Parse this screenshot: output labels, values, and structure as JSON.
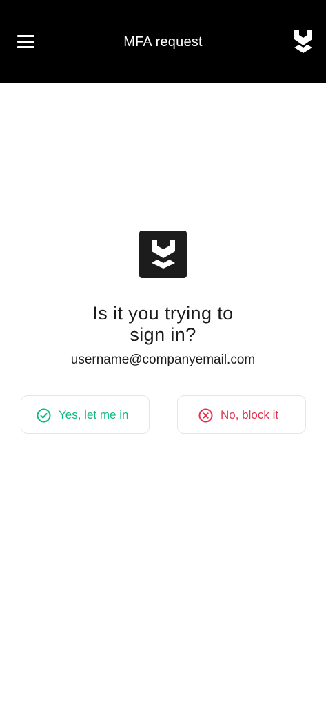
{
  "header": {
    "title": "MFA request",
    "menu_icon": "hamburger-menu-icon",
    "logo_icon": "chevron-shield-logo-icon"
  },
  "main": {
    "logo_icon": "chevron-shield-logo-icon",
    "question_line1": "Is it you trying to",
    "question_line2": "sign in?",
    "email": "username@companyemail.com"
  },
  "actions": {
    "approve": {
      "label": "Yes, let me in",
      "icon": "check-circle-icon",
      "color": "#10b981"
    },
    "deny": {
      "label": "No, block it",
      "icon": "x-circle-icon",
      "color": "#e1334f"
    }
  },
  "colors": {
    "header_bg": "#000000",
    "page_bg": "#ffffff",
    "text": "#1a1a1a"
  }
}
